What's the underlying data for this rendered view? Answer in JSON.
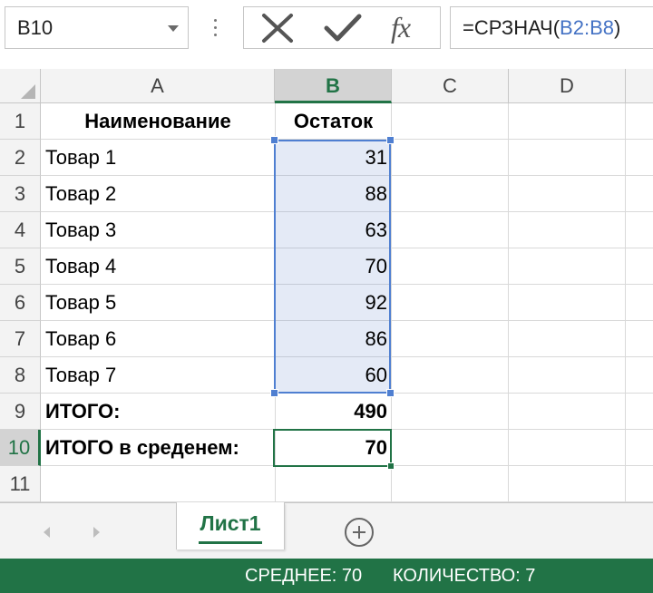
{
  "formula_bar": {
    "name_box": "B10",
    "cancel_icon": "x-icon",
    "enter_icon": "checkmark-icon",
    "fx_label": "fx",
    "formula_prefix": "=СРЗНАЧ(",
    "formula_ref": "B2:B8",
    "formula_suffix": ")"
  },
  "columns": [
    "A",
    "B",
    "C",
    "D"
  ],
  "active_column": "B",
  "rows": [
    {
      "num": "1",
      "a": "Наименование",
      "b": "Остаток",
      "bold": true
    },
    {
      "num": "2",
      "a": "Товар 1",
      "b": "31",
      "bold": false
    },
    {
      "num": "3",
      "a": "Товар 2",
      "b": "88",
      "bold": false
    },
    {
      "num": "4",
      "a": "Товар 3",
      "b": "63",
      "bold": false
    },
    {
      "num": "5",
      "a": "Товар 4",
      "b": "70",
      "bold": false
    },
    {
      "num": "6",
      "a": "Товар 5",
      "b": "92",
      "bold": false
    },
    {
      "num": "7",
      "a": "Товар 6",
      "b": "86",
      "bold": false
    },
    {
      "num": "8",
      "a": "Товар 7",
      "b": "60",
      "bold": false
    },
    {
      "num": "9",
      "a": "ИТОГО:",
      "b": "490",
      "bold": true
    },
    {
      "num": "10",
      "a": "ИТОГО в среденем:",
      "b": "70",
      "bold": true
    },
    {
      "num": "11",
      "a": "",
      "b": "",
      "bold": false
    }
  ],
  "active_row": "10",
  "selection_range": "B2:B8",
  "sheet_tabs": {
    "active": "Лист1",
    "add_icon": "plus-circle-icon"
  },
  "status_bar": {
    "average": "СРЕДНЕЕ: 70",
    "count": "КОЛИЧЕСТВО: 7"
  },
  "colors": {
    "accent_green": "#217346",
    "selection_blue": "#4f7fd1",
    "reference_blue": "#4472c4"
  }
}
